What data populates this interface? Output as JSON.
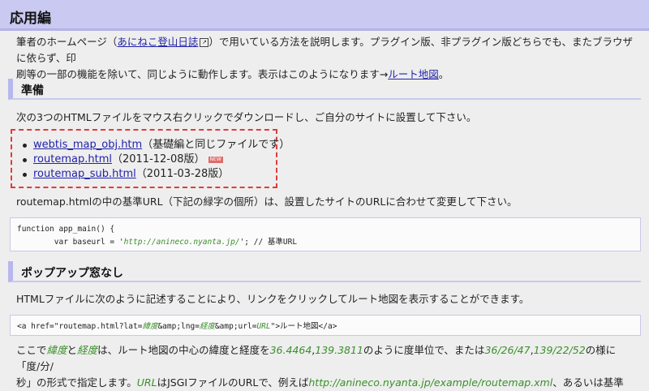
{
  "main_heading": "応用編",
  "intro": {
    "pre": "筆者のホームページ（",
    "link": "あにねこ登山日誌",
    "post1": "）で用いている方法を説明します。プラグイン版、非プラグイン版どちらでも、またブラウザに依らず、印",
    "line2_pre": "刷等の一部の機能を除いて、同じように動作します。表示はこのようになります→",
    "link2": "ルート地図",
    "line2_post": "。"
  },
  "section1": {
    "heading": "準備",
    "desc": "次の3つのHTMLファイルをマウス右クリックでダウンロードし、ご自分のサイトに設置して下さい。",
    "files": [
      {
        "link": "webtis_map_obj.htm",
        "note": "（基礎編と同じファイルです）"
      },
      {
        "link": "routemap.html",
        "note": "（2011-12-08版）",
        "badge": "NEW"
      },
      {
        "link": "routemap_sub.html",
        "note": "（2011-03-28版）"
      }
    ],
    "after": "routemap.htmlの中の基準URL（下記の緑字の個所）は、設置したサイトのURLに合わせて変更して下さい。",
    "code_line1": "function app_main() {",
    "code_line2_pre": "        var baseurl = '",
    "code_line2_url": "http://anineco.nyanta.jp/",
    "code_line2_post": "'; // 基準URL"
  },
  "section2": {
    "heading": "ポップアップ窓なし",
    "desc": "HTMLファイルに次のように記述することにより、リンクをクリックしてルート地図を表示することができます。",
    "code_pre": "<a href=\"routemap.html?lat=",
    "code_lat": "緯度",
    "code_mid1": "&amp;lng=",
    "code_lng": "経度",
    "code_mid2": "&amp;url=",
    "code_url": "URL",
    "code_post": "\">ルート地図</a>",
    "tail": {
      "p1": "ここで",
      "lat": "緯度",
      "p2": "と",
      "lng": "経度",
      "p3": "は、ルート地図の中心の緯度と経度を",
      "v1": "36.4464",
      "comma": ",",
      "v2": "139.3811",
      "p4": "のように度単位で、または",
      "v3": "36/26/47",
      "v4": "139/22/52",
      "p5": "の様に「度/分/",
      "line2_p1": "秒」の形式で指定します。",
      "url": "URL",
      "line2_p2": "はJSGIファイルのURLで、例えば",
      "example": "http://anineco.nyanta.jp/example/routemap.xml",
      "line2_p3": "、あるいは基準"
    }
  }
}
